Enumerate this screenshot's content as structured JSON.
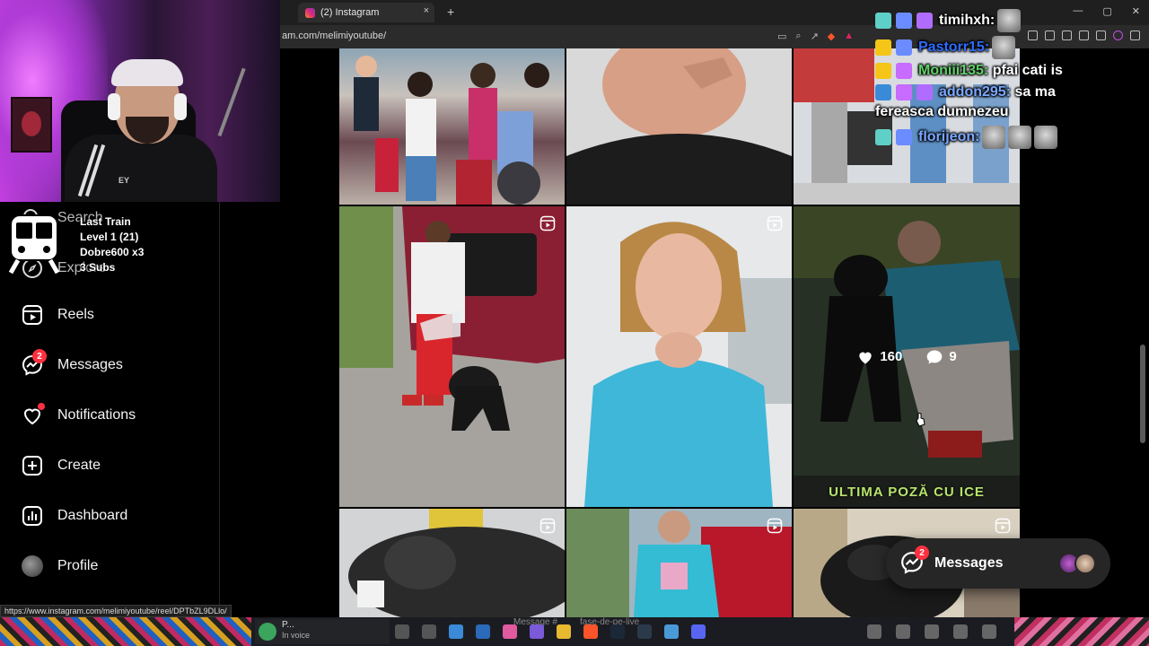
{
  "browser": {
    "tab_title": "(2) Instagram",
    "tab_close": "×",
    "new_tab": "+",
    "url": "am.com/melimiyoutube/",
    "status_url": "https://www.instagram.com/melimiyoutube/reel/DPTbZL9DLlo/"
  },
  "stream_overlay": {
    "train_title": "Last Train",
    "train_level": "Level 1  (21)",
    "train_top": "Dobre600 x3",
    "train_subs": "3 Subs",
    "cam_text": "EY"
  },
  "sidebar": {
    "items": [
      {
        "label": "Search",
        "icon": "search-icon"
      },
      {
        "label": "Explore",
        "icon": "compass-icon"
      },
      {
        "label": "Reels",
        "icon": "reels-icon"
      },
      {
        "label": "Messages",
        "icon": "messenger-icon",
        "badge": "2"
      },
      {
        "label": "Notifications",
        "icon": "heart-icon"
      },
      {
        "label": "Create",
        "icon": "plus-square-icon"
      },
      {
        "label": "Dashboard",
        "icon": "chart-icon"
      },
      {
        "label": "Profile",
        "icon": "avatar"
      }
    ]
  },
  "grid": {
    "hover_likes": "160",
    "hover_comments": "9",
    "caption": "ULTIMA POZĂ CU ICE"
  },
  "chat": [
    {
      "user": "timihxh:",
      "message": "",
      "color": "#ffffff"
    },
    {
      "user": "Pastorr15:",
      "message": "",
      "color": "#2e6bff"
    },
    {
      "user": "Moniii135:",
      "message": "pfai cati is",
      "color": "#5fd068"
    },
    {
      "user": "addon295:",
      "message": "sa ma fereasca dumnezeu",
      "color": "#7aa8ff"
    },
    {
      "user": "florijeon:",
      "message": "",
      "color": "#7aa8ff"
    }
  ],
  "messages_pill": {
    "label": "Messages",
    "badge": "2"
  },
  "taskbar": {
    "discord_name": "P...",
    "discord_status": "In voice",
    "message_hint": "Message #",
    "channel_hint": "fase-de-pe-live"
  },
  "colors": {
    "accent_red": "#ff3040",
    "ig_bg": "#000000",
    "pill_bg": "#262626"
  }
}
